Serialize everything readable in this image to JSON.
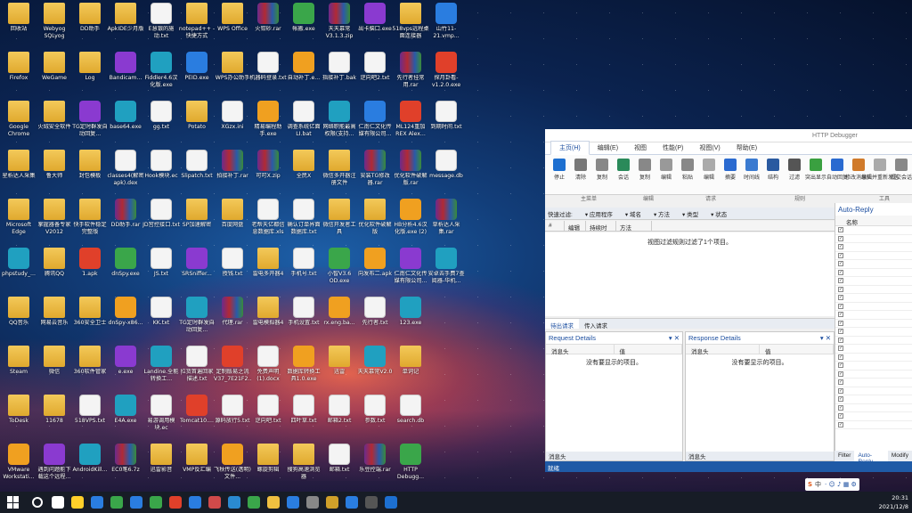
{
  "desktop_icons": [
    [
      "回收站",
      "Webyog SQLyog",
      "DD助手",
      "ApkIDE少月版",
      "E慧银的施动.txt",
      "notepad++ - 快捷方式",
      "WPS Office",
      "火钳砂.rar",
      "帐搬.exe",
      "天天慕常V3.1.3.zip",
      "出卡脑口.exe",
      "518vps远程桌面连接器",
      "山竹11-21.vmp..."
    ],
    [
      "Firefox",
      "WeGame",
      "Log",
      "Bandicam...",
      "Fiddler4.6汉化版.exe",
      "PEID.exe",
      "WPS办公助手",
      "机器码登录.txt",
      "自动补丁.e...",
      "指接补丁.bak",
      "逆向吧2.txt",
      "先行者挂常用.rar",
      "探月卦看-v1.2.0.exe"
    ],
    [
      "Google Chrome",
      "火绒安全软件",
      "TG定时群发自动回复...",
      "base64.exe",
      "gg.txt",
      "Potato",
      "XGzx.ini",
      "精易编程助手.exe",
      "调查系统亿面LI.bat",
      "网络职能最高权限(支持...",
      "仁南仁文化传媒有限公司...",
      "ML124重加REX Alex...",
      "到期时间.txt"
    ],
    [
      "星析达人采集",
      "鲁大师",
      "封包模板",
      "classes4(解密apk).dex",
      "Hook模块.ec",
      "Slipatch.txt",
      "拍接补丁.rar",
      "可可X.zip",
      "全民X",
      "微信多开器注册文件",
      "安装TG修改器.rar",
      "优化软件破解版.rar",
      "message.db"
    ],
    [
      "Microsoft Edge",
      "掌握器备专家V2012",
      "快手软件稳定完整版",
      "DD助手.rar",
      "JD宫控接口.txt",
      "SP加速解密",
      "百度网盘",
      "老帮天亿都信息数据库.xls",
      "确认订单界面数据库.txt",
      "微信开发者工具",
      "优化软件破解版",
      "HB分析4.6汉化版.exe (2)",
      "草析达人采集.rar"
    ],
    [
      "phpstudy_...",
      "腾讯QQ",
      "1.apk",
      "dnSpy.exe",
      "JS.txt",
      "SRSniffer...",
      "授钱.txt",
      "雷电多开器4",
      "手机号.txt",
      "小智V3.6 OD.exe",
      "向发布二.apk",
      "仁南仁文化传媒有限公司...",
      "安卓去手费7查阅器-华机..."
    ],
    [
      "QQ音乐",
      "网易云音乐",
      "360安全卫士",
      "dnSpy-x86...",
      "KK.txt",
      "TG定时群发自动回复...",
      "代理.rar",
      "雷电模拟器4",
      "手机设置.txt",
      "rx.eng.ba...",
      "先行者.txt",
      "123.exe",
      ""
    ],
    [
      "Steam",
      "微信",
      "360软件管家",
      "e.exe",
      "Landine.全能转换工...",
      "拉货首遍回家描述.txt",
      "定制版易之流V37_7E21F2...",
      "免费声明(1).docx",
      "数据库转换工具1.0.exe",
      "迅雷",
      "天天慕常V2.0",
      "单词记",
      ""
    ],
    [
      "ToDesk",
      "11678",
      "518VPS.txt",
      "E4A.exe",
      "易游调用模块.ec",
      "Tomcat10....",
      "源码放行5.txt",
      "逆向吧.txt",
      "四叶草.txt",
      "邮箱2.txt",
      "参数.txt",
      "search.db",
      ""
    ],
    [
      "VMware Workstati...",
      "遇到问题能下载这个远程...",
      "AndroidKill...",
      "EC0笔6.7z",
      "迅雷影音",
      "VMP反汇编",
      "飞秋传送(透明)文件...",
      "螺旋剪辑",
      "搜狗高速浏览器",
      "邮箱.txt",
      "乐豆控端.rar",
      "HTTP Debugg...",
      ""
    ]
  ],
  "window": {
    "title": "HTTP Debugger",
    "tabs": [
      "主页(H)",
      "编辑(E)",
      "视图",
      "性能(P)",
      "视图(V)",
      "帮助(E)"
    ],
    "ribbon": [
      "停止",
      "清除",
      "复制",
      "会话",
      "复制",
      "编辑",
      "粘贴",
      "编辑",
      "摘要",
      "时间线",
      "结构",
      "过滤",
      "突出显示",
      "自动回复",
      "修改消息头",
      "编辑并重新发送",
      "提交会话"
    ],
    "groups": [
      "主菜单",
      "编辑",
      "请求",
      "规则",
      "工具"
    ],
    "filters": [
      "快速过滤:",
      "应用程序",
      "域名",
      "方法",
      "类型",
      "状态"
    ],
    "columns": [
      "#",
      "编辑",
      "持续时间",
      "方法"
    ],
    "empty_msg": "视图过滤规则过滤了1个项目。",
    "subtabs": [
      "待出请求",
      "传入请求"
    ],
    "request_title": "Request Details",
    "response_title": "Response Details",
    "col_header": "消息头",
    "col_value": "值",
    "no_items": "没有要显示的项目。",
    "pane_footer": "消息头",
    "auto_title": "Auto-Reply",
    "auto_col": "名称",
    "auto_rows": 24,
    "bottom_tabs": [
      "Filter",
      "Auto-Reply",
      "Modify"
    ],
    "status": "就绪"
  },
  "tray": {
    "time": "20:31",
    "date": "2021/12/8",
    "ime": "中"
  }
}
